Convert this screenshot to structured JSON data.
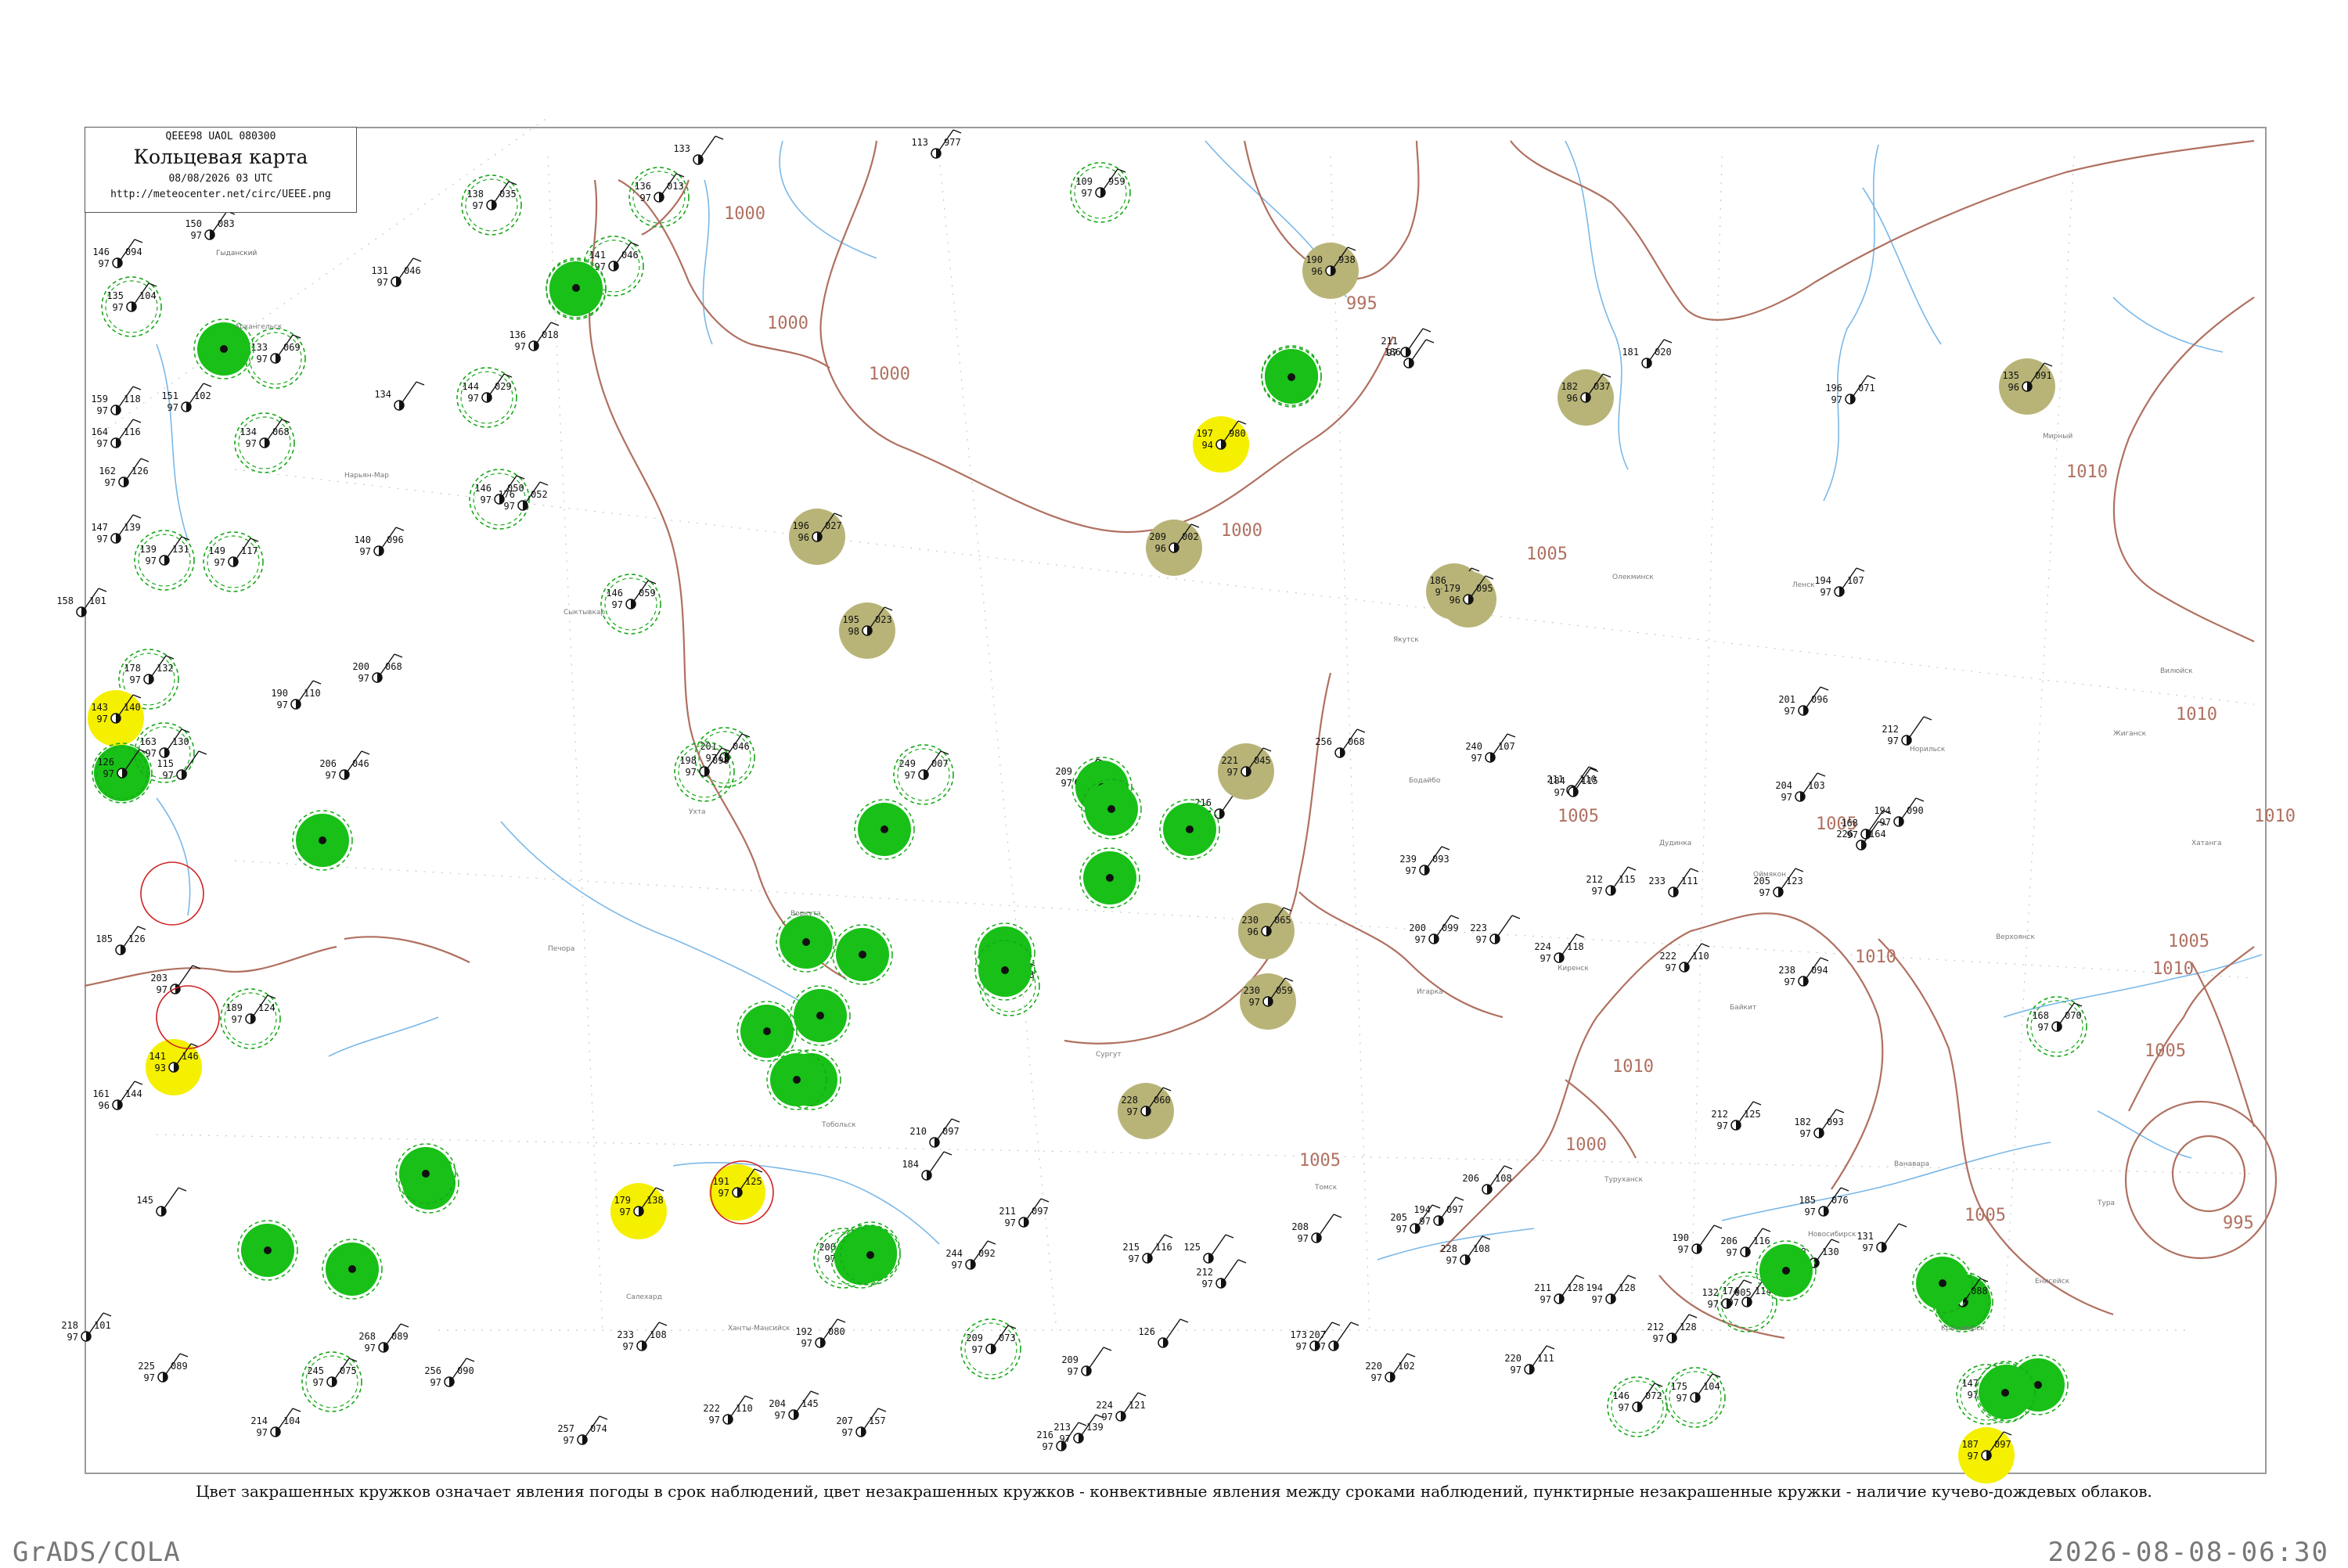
{
  "title_box": {
    "code": "QEEE98  UAOL  080300",
    "title": "Кольцевая карта",
    "date": "08/08/2026 03 UTC",
    "url": "http://meteocenter.net/circ/UEEE.png"
  },
  "legend_text": "Цвет закрашенных кружков означает явления погоды в срок наблюдений, цвет незакрашенных кружков - конвективные явления между сроками наблюдений, пунктирные незакрашенные кружки - наличие кучево-дождевых облаков.",
  "footer": {
    "left": "GrADS/COLA",
    "right": "2026-08-08-06:30"
  },
  "colors": {
    "isobar": "#b07060",
    "river": "#7ab8e8",
    "rain_fill": "#18c018",
    "haze_fill": "#b8b478",
    "fog_fill": "#f4f000",
    "cb_ring": "#18a818",
    "thunder_ring": "#d02020"
  },
  "isobars": [
    {
      "label": "1000"
    },
    {
      "label": "1000"
    },
    {
      "label": "1000"
    },
    {
      "label": "1000"
    },
    {
      "label": "995"
    },
    {
      "label": "1005"
    },
    {
      "label": "1005"
    },
    {
      "label": "1005"
    },
    {
      "label": "1005"
    },
    {
      "label": "1010"
    },
    {
      "label": "1010"
    },
    {
      "label": "1010"
    },
    {
      "label": "1005"
    },
    {
      "label": "1005"
    },
    {
      "label": "1000"
    },
    {
      "label": "995"
    },
    {
      "label": "1005"
    },
    {
      "label": "1010"
    },
    {
      "label": "1010"
    },
    {
      "label": "1010"
    }
  ],
  "stations": [
    {
      "t": "150",
      "d": "97",
      "p": "083",
      "wx": "filled-none",
      "name": "Гыданский"
    },
    {
      "t": "146",
      "d": "97",
      "p": "094",
      "wx": "none"
    },
    {
      "t": "135",
      "d": "97",
      "p": "104",
      "wx": "cb"
    },
    {
      "t": "133",
      "d": "97",
      "p": "069",
      "wx": "cb"
    },
    {
      "t": "159",
      "d": "97",
      "p": "118",
      "wx": "none"
    },
    {
      "t": "151",
      "d": "97",
      "p": "102",
      "wx": "none"
    },
    {
      "t": "164",
      "d": "97",
      "p": "116",
      "wx": "none"
    },
    {
      "t": "162",
      "d": "97",
      "p": "126",
      "wx": "none"
    },
    {
      "t": "134",
      "d": "97",
      "p": "068",
      "wx": "cb"
    },
    {
      "t": "131",
      "d": "97",
      "p": "046",
      "wx": "none"
    },
    {
      "t": "138",
      "d": "97",
      "p": "035",
      "wx": "cb"
    },
    {
      "t": "136",
      "d": "97",
      "p": "013",
      "wx": "cb"
    },
    {
      "t": "133",
      "d": "",
      "p": "",
      "wx": "none"
    },
    {
      "t": "141",
      "d": "97",
      "p": "046",
      "wx": "cb"
    },
    {
      "t": "136",
      "d": "97",
      "p": "018",
      "wx": "none"
    },
    {
      "t": "144",
      "d": "97",
      "p": "029",
      "wx": "cb"
    },
    {
      "t": "134",
      "d": "",
      "p": "",
      "wx": "none"
    },
    {
      "t": "146",
      "d": "97",
      "p": "050",
      "wx": "cb"
    },
    {
      "t": "176",
      "d": "97",
      "p": "052",
      "wx": "none"
    },
    {
      "t": "147",
      "d": "97",
      "p": "139",
      "wx": "none"
    },
    {
      "t": "139",
      "d": "97",
      "p": "131",
      "wx": "cb"
    },
    {
      "t": "149",
      "d": "97",
      "p": "117",
      "wx": "cb"
    },
    {
      "t": "140",
      "d": "97",
      "p": "096",
      "wx": "none"
    },
    {
      "t": "158",
      "d": "",
      "p": "101",
      "wx": "none"
    },
    {
      "t": "146",
      "d": "97",
      "p": "059",
      "wx": "cb"
    },
    {
      "t": "178",
      "d": "97",
      "p": "132",
      "wx": "cb"
    },
    {
      "t": "200",
      "d": "97",
      "p": "068",
      "wx": "none"
    },
    {
      "t": "190",
      "d": "97",
      "p": "110",
      "wx": "none"
    },
    {
      "t": "143",
      "d": "97",
      "p": "140",
      "wx": "fog"
    },
    {
      "t": "126",
      "d": "97",
      "p": "",
      "wx": "rain"
    },
    {
      "t": "163",
      "d": "97",
      "p": "130",
      "wx": "cb"
    },
    {
      "t": "115",
      "d": "97",
      "p": "",
      "wx": "none"
    },
    {
      "t": "206",
      "d": "97",
      "p": "046",
      "wx": "none"
    },
    {
      "t": "201",
      "d": "97",
      "p": "046",
      "wx": "cb"
    },
    {
      "t": "198",
      "d": "97",
      "p": "098",
      "wx": "cb"
    },
    {
      "t": "249",
      "d": "97",
      "p": "007",
      "wx": "cb"
    },
    {
      "t": "209",
      "d": "97",
      "p": "",
      "wx": "none"
    },
    {
      "t": "216",
      "d": "97",
      "p": "",
      "wx": "none"
    },
    {
      "t": "221",
      "d": "97",
      "p": "045",
      "wx": "haze"
    },
    {
      "t": "256",
      "d": "",
      "p": "068",
      "wx": "none"
    },
    {
      "t": "240",
      "d": "97",
      "p": "107",
      "wx": "none"
    },
    {
      "t": "211",
      "d": "",
      "p": "110",
      "wx": "none"
    },
    {
      "t": "184",
      "d": "97",
      "p": "115",
      "wx": "none"
    },
    {
      "t": "201",
      "d": "97",
      "p": "096",
      "wx": "none"
    },
    {
      "t": "212",
      "d": "97",
      "p": "",
      "wx": "none"
    },
    {
      "t": "204",
      "d": "97",
      "p": "103",
      "wx": "none"
    },
    {
      "t": "194",
      "d": "97",
      "p": "090",
      "wx": "none"
    },
    {
      "t": "195",
      "d": "98",
      "p": "023",
      "wx": "haze"
    },
    {
      "t": "196",
      "d": "96",
      "p": "027",
      "wx": "haze"
    },
    {
      "t": "209",
      "d": "96",
      "p": "002",
      "wx": "haze"
    },
    {
      "t": "186",
      "d": "97",
      "p": "070",
      "wx": "haze"
    },
    {
      "t": "179",
      "d": "96",
      "p": "095",
      "wx": "haze"
    },
    {
      "t": "194",
      "d": "97",
      "p": "107",
      "wx": "none"
    },
    {
      "t": "197",
      "d": "94",
      "p": "980",
      "wx": "fog"
    },
    {
      "t": "190",
      "d": "96",
      "p": "938",
      "wx": "haze"
    },
    {
      "t": "211",
      "d": "97",
      "p": "",
      "wx": "none"
    },
    {
      "t": "186",
      "d": "",
      "p": "",
      "wx": "none"
    },
    {
      "t": "181",
      "d": "",
      "p": "020",
      "wx": "none"
    },
    {
      "t": "182",
      "d": "96",
      "p": "037",
      "wx": "haze"
    },
    {
      "t": "196",
      "d": "97",
      "p": "071",
      "wx": "none"
    },
    {
      "t": "135",
      "d": "96",
      "p": "091",
      "wx": "haze"
    },
    {
      "t": "109",
      "d": "97",
      "p": "959",
      "wx": "cb"
    },
    {
      "t": "113",
      "d": "",
      "p": "977",
      "wx": "none"
    },
    {
      "t": "239",
      "d": "97",
      "p": "093",
      "wx": "none"
    },
    {
      "t": "233",
      "d": "",
      "p": "111",
      "wx": "none"
    },
    {
      "t": "212",
      "d": "97",
      "p": "115",
      "wx": "none"
    },
    {
      "t": "205",
      "d": "97",
      "p": "123",
      "wx": "none"
    },
    {
      "t": "226",
      "d": "",
      "p": "164",
      "wx": "none"
    },
    {
      "t": "168",
      "d": "97",
      "p": "",
      "wx": "none"
    },
    {
      "t": "200",
      "d": "97",
      "p": "099",
      "wx": "none"
    },
    {
      "t": "223",
      "d": "97",
      "p": "",
      "wx": "none"
    },
    {
      "t": "224",
      "d": "97",
      "p": "118",
      "wx": "none"
    },
    {
      "t": "222",
      "d": "97",
      "p": "110",
      "wx": "none"
    },
    {
      "t": "238",
      "d": "97",
      "p": "094",
      "wx": "none"
    },
    {
      "t": "230",
      "d": "96",
      "p": "065",
      "wx": "haze"
    },
    {
      "t": "230",
      "d": "97",
      "p": "059",
      "wx": "haze"
    },
    {
      "t": "228",
      "d": "97",
      "p": "060",
      "wx": "haze"
    },
    {
      "t": "208",
      "d": "97",
      "p": "033",
      "wx": "cb"
    },
    {
      "t": "185",
      "d": "97",
      "p": "076",
      "wx": "none"
    },
    {
      "t": "182",
      "d": "97",
      "p": "093",
      "wx": "none"
    },
    {
      "t": "168",
      "d": "97",
      "p": "070",
      "wx": "cb"
    },
    {
      "t": "174",
      "d": "97",
      "p": "114",
      "wx": "cb"
    },
    {
      "t": "132",
      "d": "97",
      "p": "005",
      "wx": "none"
    },
    {
      "t": "176",
      "d": "97",
      "p": "088",
      "wx": "rain"
    },
    {
      "t": "147",
      "d": "97",
      "p": "128",
      "wx": "cb"
    },
    {
      "t": "175",
      "d": "97",
      "p": "104",
      "wx": "cb"
    },
    {
      "t": "146",
      "d": "97",
      "p": "072",
      "wx": "cb"
    },
    {
      "t": "187",
      "d": "97",
      "p": "097",
      "wx": "fog"
    },
    {
      "t": "179",
      "d": "97",
      "p": "138",
      "wx": "fog"
    },
    {
      "t": "191",
      "d": "97",
      "p": "125",
      "wx": "fog"
    },
    {
      "t": "141",
      "d": "93",
      "p": "146",
      "wx": "fog"
    },
    {
      "t": "189",
      "d": "97",
      "p": "124",
      "wx": "cb"
    },
    {
      "t": "185",
      "d": "",
      "p": "126",
      "wx": "none"
    },
    {
      "t": "203",
      "d": "97",
      "p": "",
      "wx": "none"
    },
    {
      "t": "161",
      "d": "96",
      "p": "144",
      "wx": "none"
    },
    {
      "t": "145",
      "d": "",
      "p": "",
      "wx": "none"
    },
    {
      "t": "218",
      "d": "97",
      "p": "101",
      "wx": "none"
    },
    {
      "t": "225",
      "d": "97",
      "p": "089",
      "wx": "none"
    },
    {
      "t": "214",
      "d": "97",
      "p": "104",
      "wx": "none"
    },
    {
      "t": "245",
      "d": "97",
      "p": "075",
      "wx": "cb"
    },
    {
      "t": "268",
      "d": "97",
      "p": "089",
      "wx": "none"
    },
    {
      "t": "256",
      "d": "97",
      "p": "090",
      "wx": "none"
    },
    {
      "t": "257",
      "d": "97",
      "p": "074",
      "wx": "none"
    },
    {
      "t": "233",
      "d": "97",
      "p": "108",
      "wx": "none"
    },
    {
      "t": "222",
      "d": "97",
      "p": "110",
      "wx": "none"
    },
    {
      "t": "204",
      "d": "97",
      "p": "145",
      "wx": "none"
    },
    {
      "t": "207",
      "d": "97",
      "p": "157",
      "wx": "none"
    },
    {
      "t": "213",
      "d": "97",
      "p": "139",
      "wx": "none"
    },
    {
      "t": "224",
      "d": "97",
      "p": "121",
      "wx": "none"
    },
    {
      "t": "209",
      "d": "97",
      "p": "073",
      "wx": "cb"
    },
    {
      "t": "200",
      "d": "97",
      "p": "098",
      "wx": "cb"
    },
    {
      "t": "192",
      "d": "97",
      "p": "080",
      "wx": "none"
    },
    {
      "t": "184",
      "d": "",
      "p": "",
      "wx": "none"
    },
    {
      "t": "210",
      "d": "",
      "p": "097",
      "wx": "none"
    },
    {
      "t": "211",
      "d": "97",
      "p": "097",
      "wx": "none"
    },
    {
      "t": "244",
      "d": "97",
      "p": "092",
      "wx": "none"
    },
    {
      "t": "215",
      "d": "97",
      "p": "116",
      "wx": "none"
    },
    {
      "t": "212",
      "d": "97",
      "p": "",
      "wx": "none"
    },
    {
      "t": "208",
      "d": "97",
      "p": "",
      "wx": "none"
    },
    {
      "t": "173",
      "d": "97",
      "p": "",
      "wx": "none"
    },
    {
      "t": "205",
      "d": "97",
      "p": "",
      "wx": "none"
    },
    {
      "t": "194",
      "d": "97",
      "p": "097",
      "wx": "none"
    },
    {
      "t": "206",
      "d": "",
      "p": "108",
      "wx": "none"
    },
    {
      "t": "228",
      "d": "97",
      "p": "108",
      "wx": "none"
    },
    {
      "t": "211",
      "d": "97",
      "p": "128",
      "wx": "none"
    },
    {
      "t": "220",
      "d": "97",
      "p": "111",
      "wx": "none"
    },
    {
      "t": "220",
      "d": "97",
      "p": "102",
      "wx": "none"
    },
    {
      "t": "194",
      "d": "97",
      "p": "128",
      "wx": "none"
    },
    {
      "t": "212",
      "d": "97",
      "p": "128",
      "wx": "none"
    },
    {
      "t": "190",
      "d": "97",
      "p": "",
      "wx": "none"
    },
    {
      "t": "212",
      "d": "97",
      "p": "125",
      "wx": "none"
    },
    {
      "t": "206",
      "d": "97",
      "p": "116",
      "wx": "none"
    },
    {
      "t": "218",
      "d": "97",
      "p": "130",
      "wx": "none"
    },
    {
      "t": "131",
      "d": "97",
      "p": "",
      "wx": "none"
    },
    {
      "t": "126",
      "d": "",
      "p": "",
      "wx": "none"
    },
    {
      "t": "209",
      "d": "97",
      "p": "",
      "wx": "none"
    },
    {
      "t": "125",
      "d": "",
      "p": "",
      "wx": "none"
    },
    {
      "t": "207",
      "d": "97",
      "p": "",
      "wx": "none"
    },
    {
      "t": "216",
      "d": "97",
      "p": "",
      "wx": "none"
    }
  ],
  "rain_circles": 32,
  "place_labels": [
    "Архангельск",
    "Нарьян-Мар",
    "Сыктывкар",
    "Ухта",
    "Печора",
    "Воркута",
    "Салехард",
    "Ханты-Мансийск",
    "Сургут",
    "Тобольск",
    "Томск",
    "Новосибирск",
    "Красноярск",
    "Енисейск",
    "Туруханск",
    "Игарка",
    "Дудинка",
    "Норильск",
    "Хатанга",
    "Тура",
    "Ванавара",
    "Байкит",
    "Киренск",
    "Бодайбо",
    "Якутск",
    "Олекминск",
    "Ленск",
    "Мирный",
    "Вилюйск",
    "Жиганск",
    "Верхоянск",
    "Оймякон"
  ]
}
